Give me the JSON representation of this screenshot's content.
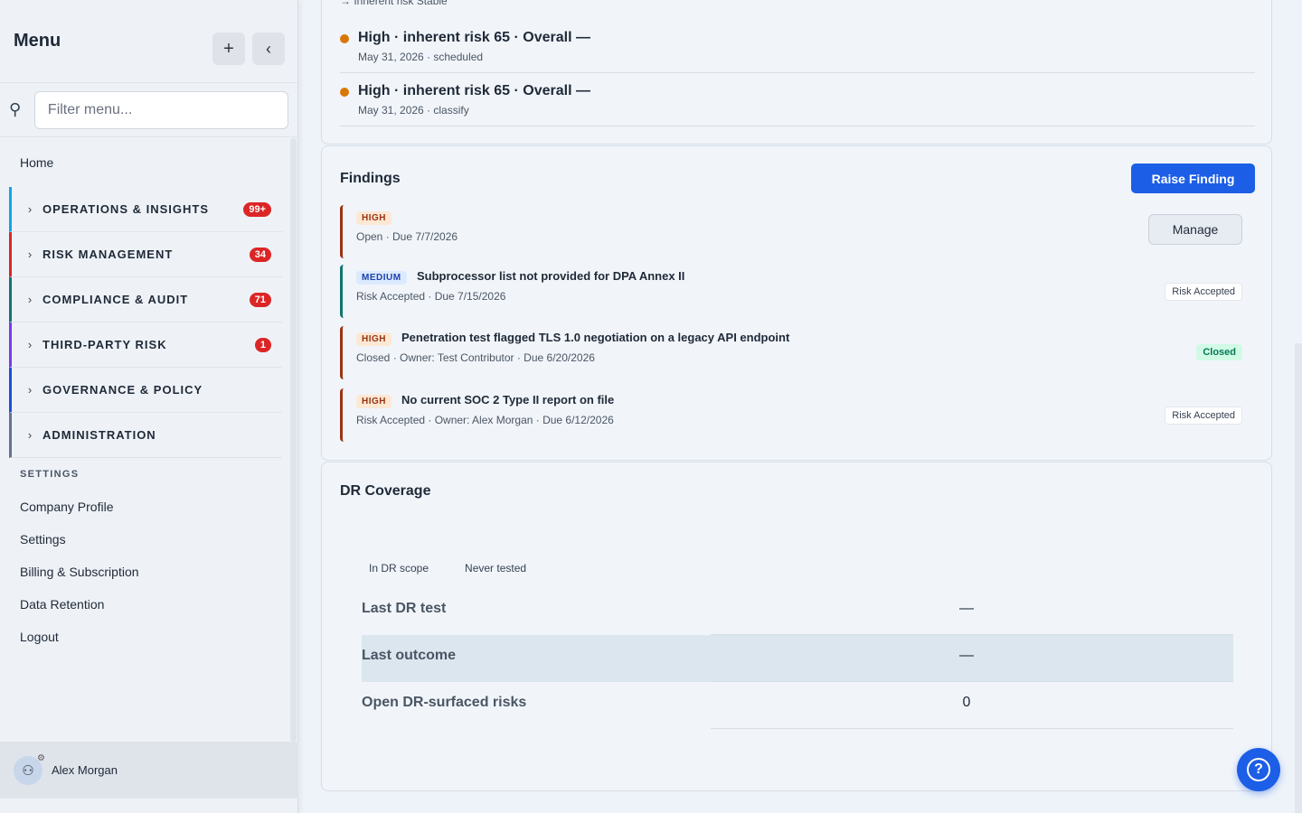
{
  "sidebar": {
    "title": "Menu",
    "add_icon": "plus-icon",
    "collapse_icon": "chevron-left-icon",
    "filter_placeholder": "Filter menu...",
    "home": "Home",
    "groups": [
      {
        "label": "OPERATIONS & INSIGHTS",
        "badge": "99+",
        "color": "#0ea5e9"
      },
      {
        "label": "RISK MANAGEMENT",
        "badge": "34",
        "color": "#dc2626"
      },
      {
        "label": "COMPLIANCE & AUDIT",
        "badge": "71",
        "color": "#0f766e"
      },
      {
        "label": "THIRD-PARTY RISK",
        "badge": "1",
        "color": "#7c3aed"
      },
      {
        "label": "GOVERNANCE & POLICY",
        "badge": "",
        "color": "#1d4ed8"
      },
      {
        "label": "ADMINISTRATION",
        "badge": "",
        "color": "#64748b"
      }
    ],
    "settings_heading": "SETTINGS",
    "settings_links": [
      "Company Profile",
      "Settings",
      "Billing & Subscription",
      "Data Retention",
      "Logout"
    ],
    "user_name": "Alex Morgan"
  },
  "activity": {
    "cut_text": "→ Inherent risk Stable",
    "items": [
      {
        "title": "High · inherent risk 65 · Overall —",
        "sub": "May 31, 2026 · scheduled"
      },
      {
        "title": "High · inherent risk 65 · Overall —",
        "sub": "May 31, 2026 · classify"
      }
    ]
  },
  "findings": {
    "title": "Findings",
    "raise_label": "Raise Finding",
    "manage_label": "Manage",
    "items": [
      {
        "severity": "HIGH",
        "title": "",
        "sub": "Open · Due 7/7/2026",
        "status": "",
        "color": "#9a3412"
      },
      {
        "severity": "MEDIUM",
        "title": "Subprocessor list not provided for DPA Annex II",
        "sub": "Risk Accepted · Due 7/15/2026",
        "status": "Risk Accepted",
        "color": "#0f766e"
      },
      {
        "severity": "HIGH",
        "title": "Penetration test flagged TLS 1.0 negotiation on a legacy API endpoint",
        "sub": "Closed · Owner: Test Contributor · Due 6/20/2026",
        "status": "Closed",
        "color": "#9a3412"
      },
      {
        "severity": "HIGH",
        "title": "No current SOC 2 Type II report on file",
        "sub": "Risk Accepted · Owner: Alex Morgan · Due 6/12/2026",
        "status": "Risk Accepted",
        "color": "#9a3412"
      }
    ]
  },
  "dr": {
    "title": "DR Coverage",
    "tabs": [
      "In DR scope",
      "Never tested"
    ],
    "rows": [
      {
        "label": "Last DR test",
        "value": "—"
      },
      {
        "label": "Last outcome",
        "value": "—"
      },
      {
        "label": "Open DR-surfaced risks",
        "value": "0"
      }
    ]
  },
  "help_icon": "question-circle-icon"
}
